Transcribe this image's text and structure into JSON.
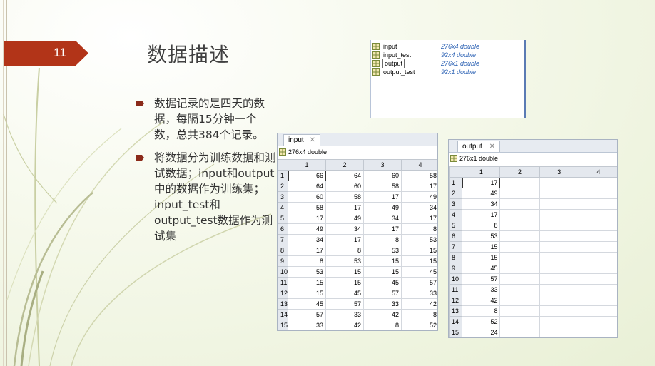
{
  "slide": {
    "number": "11",
    "title": "数据描述",
    "bullets": [
      "数据记录的是四天的数据，每隔15分钟一个数，总共384个记录。",
      "将数据分为训练数据和测试数据；input和output中的数据作为训练集；input_test和output_test数据作为测试集"
    ]
  },
  "colors": {
    "badge": "#b23418",
    "bullet": "#8b2a1a",
    "workspace_value": "#2f64b5"
  },
  "workspace": {
    "variables": [
      {
        "name": "input",
        "value": "276x4 double",
        "icon": "matrix-icon"
      },
      {
        "name": "input_test",
        "value": "92x4 double",
        "icon": "matrix-icon"
      },
      {
        "name": "output",
        "value": "276x1 double",
        "icon": "matrix-icon",
        "selected": true
      },
      {
        "name": "output_test",
        "value": "92x1 double",
        "icon": "matrix-icon"
      }
    ]
  },
  "input_editor": {
    "tab_label": "input",
    "close_icon": "close-icon",
    "info": "276x4 double",
    "columns": [
      "1",
      "2",
      "3",
      "4"
    ],
    "rows": [
      {
        "row": "1",
        "cells": [
          "66",
          "64",
          "60",
          "58"
        ]
      },
      {
        "row": "2",
        "cells": [
          "64",
          "60",
          "58",
          "17"
        ]
      },
      {
        "row": "3",
        "cells": [
          "60",
          "58",
          "17",
          "49"
        ]
      },
      {
        "row": "4",
        "cells": [
          "58",
          "17",
          "49",
          "34"
        ]
      },
      {
        "row": "5",
        "cells": [
          "17",
          "49",
          "34",
          "17"
        ]
      },
      {
        "row": "6",
        "cells": [
          "49",
          "34",
          "17",
          "8"
        ]
      },
      {
        "row": "7",
        "cells": [
          "34",
          "17",
          "8",
          "53"
        ]
      },
      {
        "row": "8",
        "cells": [
          "17",
          "8",
          "53",
          "15"
        ]
      },
      {
        "row": "9",
        "cells": [
          "8",
          "53",
          "15",
          "15"
        ]
      },
      {
        "row": "10",
        "cells": [
          "53",
          "15",
          "15",
          "45"
        ]
      },
      {
        "row": "11",
        "cells": [
          "15",
          "15",
          "45",
          "57"
        ]
      },
      {
        "row": "12",
        "cells": [
          "15",
          "45",
          "57",
          "33"
        ]
      },
      {
        "row": "13",
        "cells": [
          "45",
          "57",
          "33",
          "42"
        ]
      },
      {
        "row": "14",
        "cells": [
          "57",
          "33",
          "42",
          "8"
        ]
      },
      {
        "row": "15",
        "cells": [
          "33",
          "42",
          "8",
          "52"
        ]
      }
    ]
  },
  "output_editor": {
    "tab_label": "output",
    "close_icon": "close-icon",
    "info": "276x1 double",
    "columns": [
      "1",
      "2",
      "3",
      "4"
    ],
    "rows": [
      {
        "row": "1",
        "cells": [
          "17",
          "",
          "",
          ""
        ]
      },
      {
        "row": "2",
        "cells": [
          "49",
          "",
          "",
          ""
        ]
      },
      {
        "row": "3",
        "cells": [
          "34",
          "",
          "",
          ""
        ]
      },
      {
        "row": "4",
        "cells": [
          "17",
          "",
          "",
          ""
        ]
      },
      {
        "row": "5",
        "cells": [
          "8",
          "",
          "",
          ""
        ]
      },
      {
        "row": "6",
        "cells": [
          "53",
          "",
          "",
          ""
        ]
      },
      {
        "row": "7",
        "cells": [
          "15",
          "",
          "",
          ""
        ]
      },
      {
        "row": "8",
        "cells": [
          "15",
          "",
          "",
          ""
        ]
      },
      {
        "row": "9",
        "cells": [
          "45",
          "",
          "",
          ""
        ]
      },
      {
        "row": "10",
        "cells": [
          "57",
          "",
          "",
          ""
        ]
      },
      {
        "row": "11",
        "cells": [
          "33",
          "",
          "",
          ""
        ]
      },
      {
        "row": "12",
        "cells": [
          "42",
          "",
          "",
          ""
        ]
      },
      {
        "row": "13",
        "cells": [
          "8",
          "",
          "",
          ""
        ]
      },
      {
        "row": "14",
        "cells": [
          "52",
          "",
          "",
          ""
        ]
      },
      {
        "row": "15",
        "cells": [
          "24",
          "",
          "",
          ""
        ]
      }
    ]
  }
}
